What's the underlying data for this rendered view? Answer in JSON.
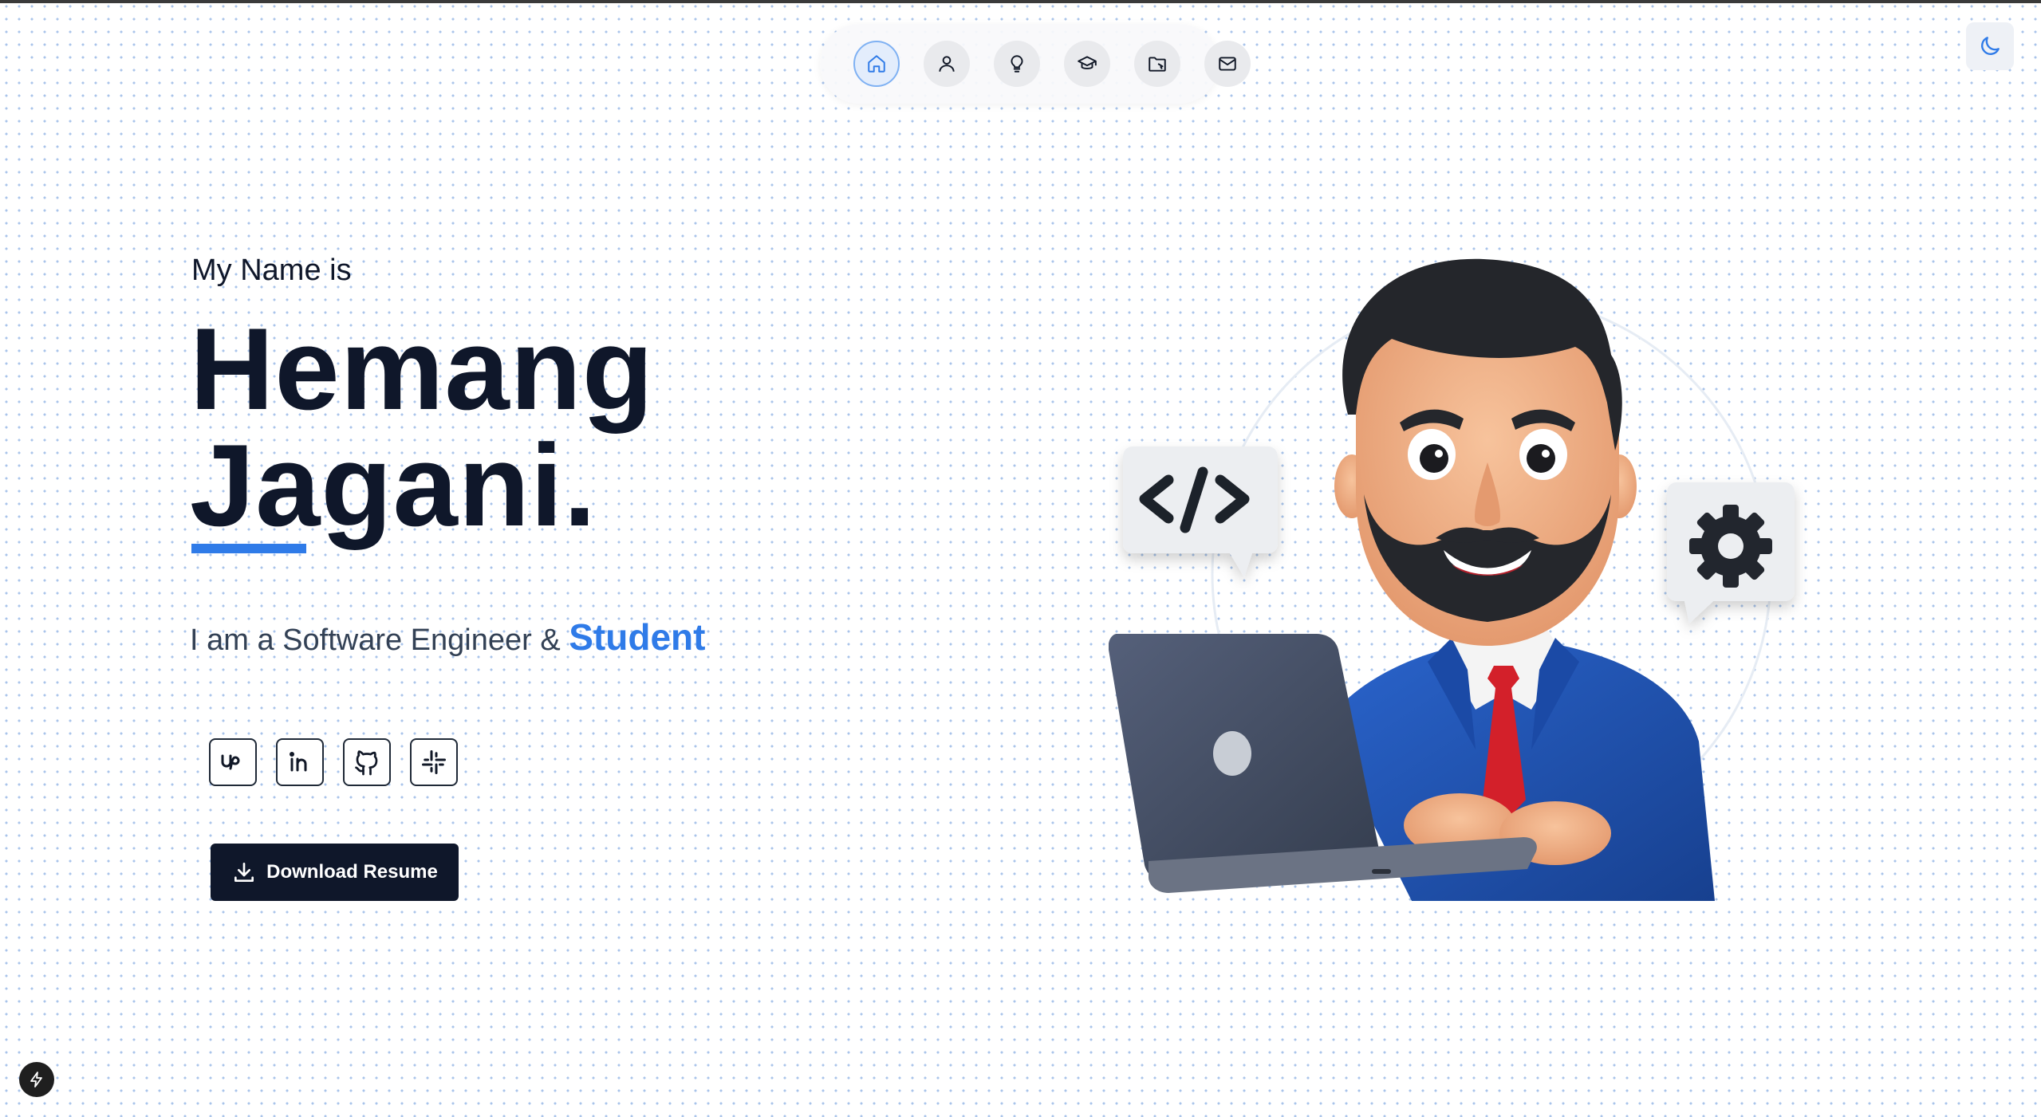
{
  "nav": {
    "items": [
      {
        "icon": "home-icon",
        "active": true
      },
      {
        "icon": "user-icon",
        "active": false
      },
      {
        "icon": "lightbulb-icon",
        "active": false
      },
      {
        "icon": "graduation-cap-icon",
        "active": false
      },
      {
        "icon": "folder-icon",
        "active": false
      },
      {
        "icon": "mail-icon",
        "active": false
      }
    ],
    "active_color": "#2f7be8"
  },
  "theme_toggle": {
    "icon": "moon-icon",
    "color": "#2f7be8"
  },
  "hero": {
    "greeting": "My Name is",
    "first_name": "Hemang",
    "last_name": "Jagani.",
    "tagline_prefix": "I am a Software Engineer & ",
    "tagline_highlight": "Student",
    "accent_color": "#2f7be8",
    "text_color": "#0f172a"
  },
  "socials": [
    {
      "icon": "upwork-icon"
    },
    {
      "icon": "linkedin-icon"
    },
    {
      "icon": "github-icon"
    },
    {
      "icon": "slack-icon"
    }
  ],
  "download": {
    "label": "Download Resume",
    "icon": "download-icon"
  },
  "illustration": {
    "icons": [
      "code-bubble-icon",
      "gear-bubble-icon",
      "laptop-icon"
    ],
    "colors": {
      "suit": "#1f4fb0",
      "tie": "#d3202a",
      "laptop": "#3f4a5c",
      "skin": "#f2b48c",
      "hair": "#24262b"
    }
  },
  "corner_badge": {
    "icon": "lightning-icon"
  }
}
